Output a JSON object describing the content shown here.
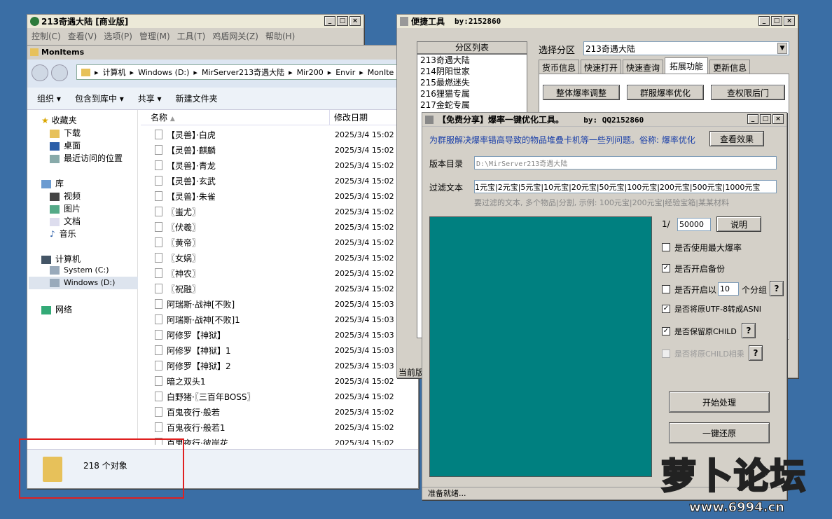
{
  "win1": {
    "title": "213奇遇大陆 [商业版]",
    "menu": [
      "控制(C)",
      "查看(V)",
      "选项(P)",
      "管理(M)",
      "工具(T)",
      "鸡盾网关(Z)",
      "帮助(H)"
    ]
  },
  "explorer": {
    "title": "MonItems",
    "address": [
      "计算机",
      "Windows (D:)",
      "MirServer213奇遇大陆",
      "Mir200",
      "Envir",
      "MonIte"
    ],
    "toolbar": [
      "组织",
      "包含到库中",
      "共享",
      "新建文件夹"
    ],
    "nav": {
      "favorites": "收藏夹",
      "downloads": "下载",
      "desktop": "桌面",
      "recent": "最近访问的位置",
      "libraries": "库",
      "videos": "视频",
      "pictures": "图片",
      "docs": "文档",
      "music": "音乐",
      "computer": "计算机",
      "system": "System (C:)",
      "windows": "Windows (D:)",
      "network": "网络"
    },
    "headers": {
      "name": "名称",
      "date": "修改日期"
    },
    "files": [
      {
        "name": "【灵兽】·白虎",
        "date": "2025/3/4 15:02"
      },
      {
        "name": "【灵兽】·麒麟",
        "date": "2025/3/4 15:02"
      },
      {
        "name": "【灵兽】·青龙",
        "date": "2025/3/4 15:02"
      },
      {
        "name": "【灵兽】·玄武",
        "date": "2025/3/4 15:02"
      },
      {
        "name": "【灵兽】·朱雀",
        "date": "2025/3/4 15:02"
      },
      {
        "name": "〖蚩尤〗",
        "date": "2025/3/4 15:02"
      },
      {
        "name": "〖伏羲〗",
        "date": "2025/3/4 15:02"
      },
      {
        "name": "〖黄帝〗",
        "date": "2025/3/4 15:02"
      },
      {
        "name": "〖女娲〗",
        "date": "2025/3/4 15:02"
      },
      {
        "name": "〖神农〗",
        "date": "2025/3/4 15:02"
      },
      {
        "name": "〖祝融〗",
        "date": "2025/3/4 15:02"
      },
      {
        "name": "阿瑞斯·战神[不败]",
        "date": "2025/3/4 15:03"
      },
      {
        "name": "阿瑞斯·战神[不败]1",
        "date": "2025/3/4 15:03"
      },
      {
        "name": "阿修罗【神狱】",
        "date": "2025/3/4 15:03"
      },
      {
        "name": "阿修罗【神狱】1",
        "date": "2025/3/4 15:03"
      },
      {
        "name": "阿修罗【神狱】2",
        "date": "2025/3/4 15:03"
      },
      {
        "name": "暗之双头1",
        "date": "2025/3/4 15:02"
      },
      {
        "name": "白野猪·〖三百年BOSS〗",
        "date": "2025/3/4 15:02"
      },
      {
        "name": "百鬼夜行·般若",
        "date": "2025/3/4 15:02"
      },
      {
        "name": "百鬼夜行·般若1",
        "date": "2025/3/4 15:02"
      },
      {
        "name": "百鬼夜行·彼岸花",
        "date": "2025/3/4 15:02"
      }
    ],
    "status": "218 个对象"
  },
  "tools": {
    "title": "便捷工具",
    "author": "by:2152860",
    "zone_list_title": "分区列表",
    "zones": [
      "213奇遇大陆",
      "214阴阳世家",
      "215最燃迷失",
      "216狸猫专属",
      "217金蛇专属"
    ],
    "select_label": "选择分区",
    "select_value": "213奇遇大陆",
    "tabs": [
      "货币信息",
      "快速打开",
      "快速查询",
      "拓展功能",
      "更新信息"
    ],
    "buttons": [
      "整体爆率调整",
      "群服爆率优化",
      "查权限后门"
    ],
    "status_partial": "当前版"
  },
  "optimizer": {
    "title": "【免费分享】爆率一键优化工具。",
    "author": "by: QQ2152860",
    "desc": "为群服解决爆率错高导致的物品堆叠卡机等一些列问题。俗称: 爆率优化",
    "view_btn": "查看效果",
    "dir_label": "版本目录",
    "dir_value": "D:\\MirServer213奇遇大陆",
    "filter_label": "过滤文本",
    "filter_value": "1元宝|2元宝|5元宝|10元宝|20元宝|50元宝|100元宝|200元宝|500元宝|1000元宝",
    "filter_hint": "要过滤的文本, 多个物品|分割, 示例: 100元宝|200元宝|经验宝箱|某某材料",
    "ratio_prefix": "1/",
    "ratio_value": "50000",
    "explain_btn": "说明",
    "options": [
      {
        "label": "是否使用最大爆率",
        "checked": false,
        "enabled": true
      },
      {
        "label": "是否开启备份",
        "checked": true,
        "enabled": true
      },
      {
        "label": "是否开启以",
        "checked": false,
        "enabled": true
      },
      {
        "label": "是否将原UTF-8转成ASNI",
        "checked": true,
        "enabled": true
      },
      {
        "label": "是否保留原CHILD",
        "checked": true,
        "enabled": true
      },
      {
        "label": "是否将原CHILD相乘",
        "checked": false,
        "enabled": false
      }
    ],
    "group_value": "10",
    "group_suffix": "个分组",
    "q": "?",
    "start_btn": "开始处理",
    "restore_btn": "一键还原",
    "status": "准备就绪..."
  },
  "watermark": {
    "logo": "萝卜论坛",
    "url": "www.6994.cn"
  }
}
